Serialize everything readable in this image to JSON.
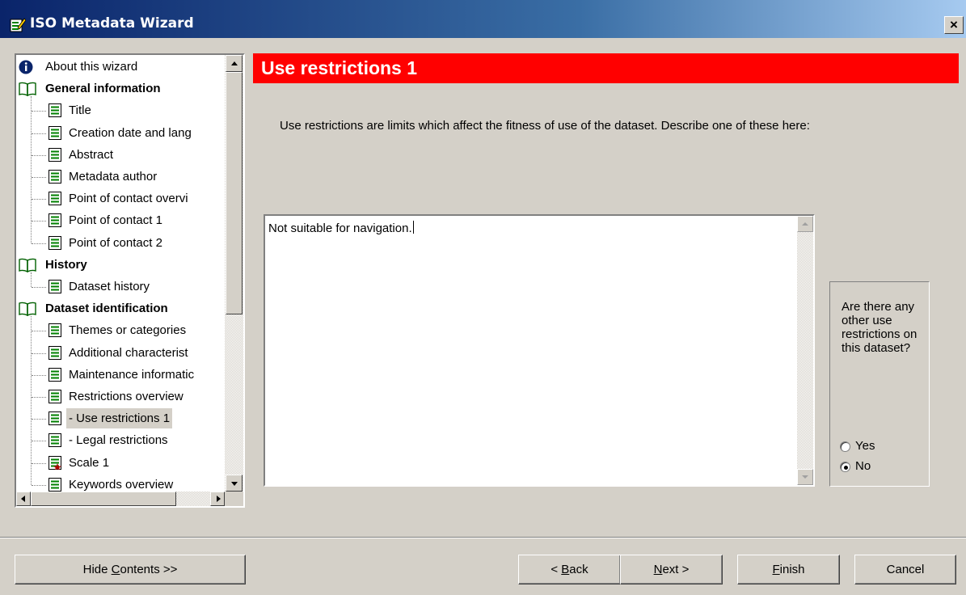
{
  "window": {
    "title": "ISO Metadata Wizard",
    "close_label": "×"
  },
  "tree": {
    "items": [
      {
        "type": "item-info",
        "label": "About this wizard"
      },
      {
        "type": "section",
        "label": "General information"
      },
      {
        "type": "child",
        "label": "Title"
      },
      {
        "type": "child",
        "label": "Creation date and lang"
      },
      {
        "type": "child",
        "label": "Abstract"
      },
      {
        "type": "child",
        "label": "Metadata author"
      },
      {
        "type": "child",
        "label": "Point of contact overvi"
      },
      {
        "type": "child",
        "label": "Point of contact 1"
      },
      {
        "type": "child",
        "label": "Point of contact 2"
      },
      {
        "type": "section",
        "label": "History"
      },
      {
        "type": "child",
        "label": "Dataset history"
      },
      {
        "type": "section",
        "label": "Dataset identification"
      },
      {
        "type": "child",
        "label": "Themes or categories"
      },
      {
        "type": "child",
        "label": "Additional characterist"
      },
      {
        "type": "child",
        "label": "Maintenance informatic"
      },
      {
        "type": "child",
        "label": "Restrictions overview"
      },
      {
        "type": "child",
        "label": "- Use restrictions 1",
        "selected": true
      },
      {
        "type": "child",
        "label": "- Legal restrictions"
      },
      {
        "type": "child-required",
        "label": "Scale 1"
      },
      {
        "type": "child",
        "label": "Keywords overview"
      }
    ]
  },
  "page": {
    "header": "Use restrictions 1",
    "description": "Use restrictions are limits which affect the fitness of use of the dataset.  Describe one of these here:",
    "text_value": "Not suitable for navigation."
  },
  "question": {
    "text": "Are there any other use restrictions on this dataset?",
    "options": [
      {
        "label": "Yes",
        "checked": false
      },
      {
        "label": "No",
        "checked": true
      }
    ]
  },
  "buttons": {
    "hide_contents_pre": "Hide ",
    "hide_contents_u": "C",
    "hide_contents_post": "ontents >>",
    "back_pre": "< ",
    "back_u": "B",
    "back_post": "ack",
    "next_u": "N",
    "next_post": "ext >",
    "finish_u": "F",
    "finish_post": "inish",
    "cancel": "Cancel"
  },
  "colors": {
    "header_bg": "#ff0000",
    "titlebar_start": "#0a246a",
    "titlebar_end": "#a6caf0",
    "window_bg": "#d4d0c8"
  }
}
